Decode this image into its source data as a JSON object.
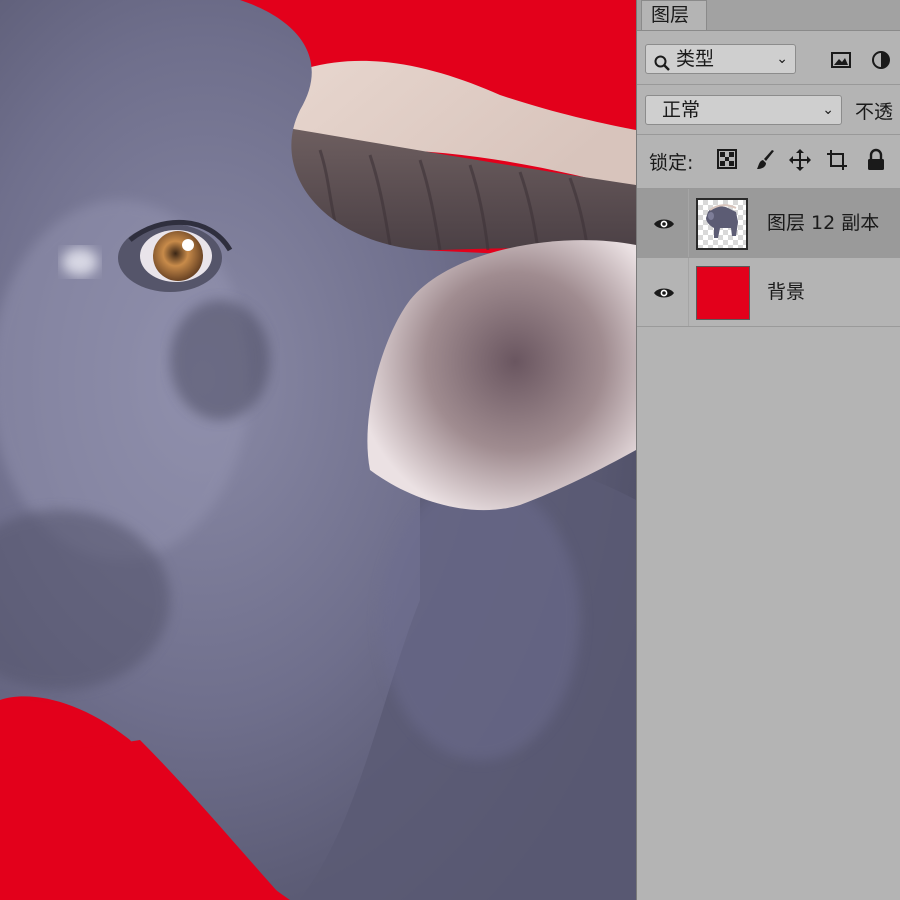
{
  "colors": {
    "canvas_bg": "#e3001b",
    "panel_bg": "#b4b4b4",
    "selected_row": "#9a9a9a",
    "bg_layer_thumb": "#e3001b"
  },
  "panel": {
    "tab_label": "图层",
    "filter": {
      "icon": "search-icon",
      "value": "类型",
      "chevron": "⌄"
    },
    "filter_icons": [
      "image-filter-icon",
      "adjustment-filter-icon"
    ],
    "blend_mode": {
      "value": "正常",
      "chevron": "⌄"
    },
    "opacity_label": "不透",
    "lock": {
      "label": "锁定:",
      "icons": [
        "lock-transparent-pixels-icon",
        "lock-image-pixels-icon",
        "lock-position-icon",
        "lock-artboard-icon",
        "lock-all-icon"
      ]
    },
    "layers": [
      {
        "name": "图层 12 副本",
        "visible": true,
        "selected": true,
        "thumb": "buffalo-thumbnail"
      },
      {
        "name": "背景",
        "visible": true,
        "selected": false,
        "thumb": "red-fill-thumbnail"
      }
    ]
  }
}
